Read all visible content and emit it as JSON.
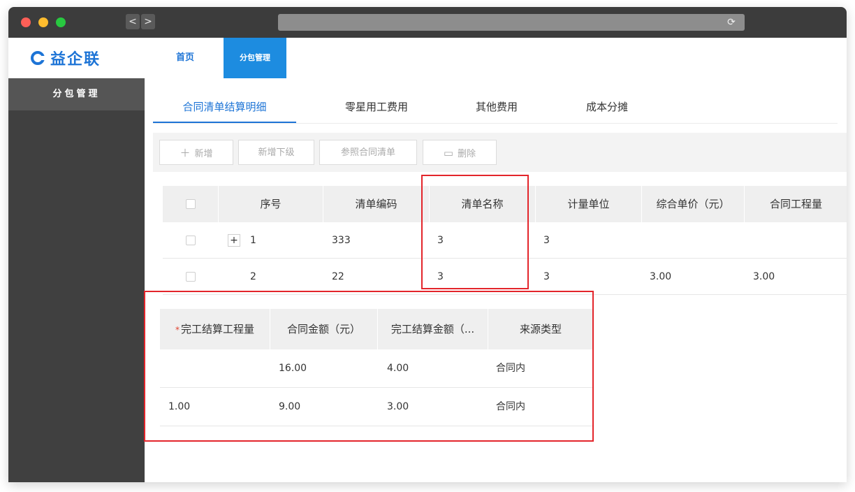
{
  "browser": {
    "back_glyph": "<",
    "forward_glyph": ">",
    "reload_glyph": "⟳",
    "url": ""
  },
  "header": {
    "logo_text": "益企联",
    "nav": [
      "首页",
      "分包管理"
    ],
    "active_nav": "分包管理"
  },
  "sidebar": {
    "items": [
      {
        "label": "分包管理"
      }
    ]
  },
  "tabs": [
    {
      "label": "合同清单结算明细"
    },
    {
      "label": "零星用工费用"
    },
    {
      "label": "其他费用"
    },
    {
      "label": "成本分摊"
    }
  ],
  "toolbar": {
    "add_label": "新增",
    "add_icon": "plus-icon",
    "add_child_label": "新增下级",
    "ref_contract_label": "参照合同清单",
    "delete_label": "删除",
    "delete_icon": "trash-icon"
  },
  "upper_table": {
    "columns": [
      "序号",
      "清单编码",
      "清单名称",
      "计量单位",
      "综合单价（元）",
      "合同工程量"
    ],
    "rows": [
      {
        "index": "1",
        "code": "333",
        "name": "3",
        "unit": "3",
        "unit_price": "",
        "qty": "",
        "expandable": true
      },
      {
        "index": "2",
        "code": "22",
        "name": "3",
        "unit": "3",
        "unit_price": "3.00",
        "qty": "3.00",
        "expandable": false
      }
    ]
  },
  "lower_table": {
    "columns": [
      "完工结算工程量",
      "合同金额（元）",
      "完工结算金额（...",
      "来源类型"
    ],
    "required_mark": "*",
    "rows": [
      {
        "settle_qty": "",
        "contract_amount": "16.00",
        "settle_amount": "4.00",
        "source": "合同内"
      },
      {
        "settle_qty": "1.00",
        "contract_amount": "9.00",
        "settle_amount": "3.00",
        "source": "合同内"
      }
    ]
  },
  "colors": {
    "accent": "#1d74d6",
    "active_nav_bg": "#1d8ce0",
    "highlight": "#e3252b",
    "sidebar": "#404040"
  }
}
